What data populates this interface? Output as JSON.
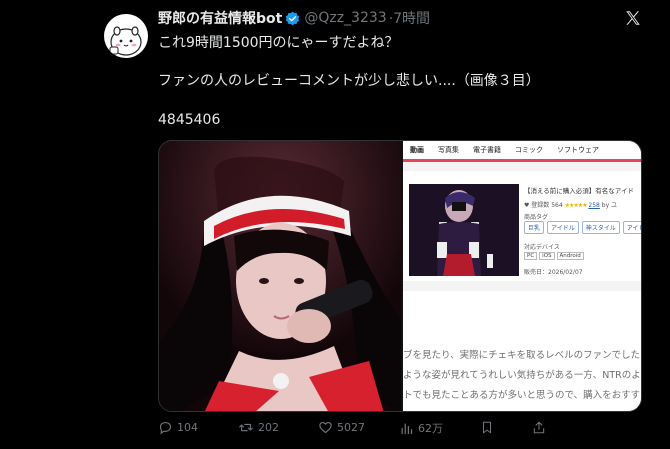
{
  "tweet": {
    "display_name": "野郎の有益情報bot",
    "handle": "@Qzz_3233",
    "time": "·7時間",
    "lines": [
      "これ9時間1500円のにゃーすだよね？",
      "ファンの人のレビューコメントが少し悲しい....（画像３目）",
      "4845406"
    ]
  },
  "media": {
    "right": {
      "tabs": [
        "動画",
        "写真集",
        "電子書籍",
        "コミック",
        "ソフトウェア"
      ],
      "product_title": "【消える前に購入必須】有名なアイド",
      "rating_prefix": "♥ 登録数 564",
      "stars": "★★★★★",
      "rating_count": "258",
      "rating_suffix": "by ユ",
      "tags_label": "商品タグ",
      "tags": [
        "巨乳",
        "アイドル",
        "神スタイル",
        "アイド"
      ],
      "devices_label": "対応デバイス",
      "devices": [
        "PC",
        "iOS",
        "Android"
      ],
      "release": "販売日：2026/02/07",
      "review_lines": [
        "ブを見たり、実際にチェキを取るレベルのファンでしたよ",
        "ような姿が見れてうれしい気持ちがある一方、NTRのよ",
        "トでも見たことある方が多いと思うので、購入をおすす"
      ]
    }
  },
  "actions": {
    "replies": "104",
    "reposts": "202",
    "likes": "5027",
    "views": "62万"
  },
  "colors": {
    "accent_red": "#e6465a",
    "verified_blue": "#1d9bf0",
    "muted_text": "#71767b"
  },
  "icons": [
    "x-logo-icon",
    "verified-badge-icon",
    "reply-icon",
    "repost-icon",
    "like-icon",
    "views-icon",
    "bookmark-icon",
    "share-icon"
  ]
}
